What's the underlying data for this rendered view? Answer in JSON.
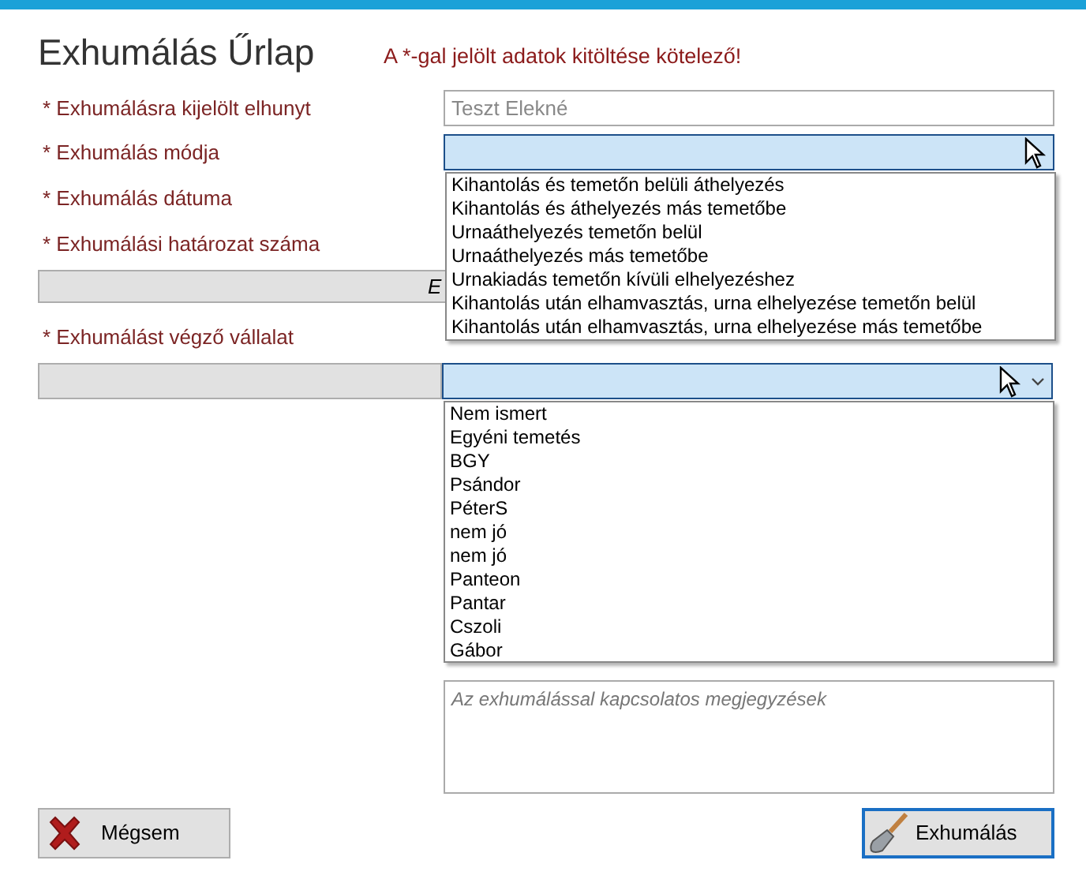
{
  "title": "Exhumálás Űrlap",
  "required_note": "A *-gal jelölt adatok kitöltése kötelező!",
  "deceased": {
    "label": "* Exhumálásra kijelölt elhunyt",
    "value": "Teszt Elekné",
    "disabled": true
  },
  "method": {
    "label": "* Exhumálás módja",
    "expanded": true,
    "options": [
      "Kihantolás és temetőn belüli áthelyezés",
      "Kihantolás és áthelyezés más temetőbe",
      "Urnaáthelyezés temetőn belül",
      "Urnaáthelyezés más temetőbe",
      "Urnakiadás temetőn kívüli elhelyezéshez",
      "Kihantolás után elhamvasztás, urna elhelyezése temetőn belül",
      "Kihantolás után elhamvasztás, urna elhelyezése más temetőbe"
    ]
  },
  "date": {
    "label": "* Exhumálás dátuma"
  },
  "resolution": {
    "label": "* Exhumálási határozat száma"
  },
  "wide_button": {
    "label": "E"
  },
  "company": {
    "label": "* Exhumálást végző vállalat",
    "expanded": true,
    "options": [
      "Nem ismert",
      "Egyéni temetés",
      "BGY",
      "Psándor",
      "PéterS",
      "nem jó",
      "nem jó",
      "Panteon",
      "Pantar",
      "Cszoli",
      "Gábor"
    ]
  },
  "notes": {
    "placeholder": "Az exhumálással kapcsolatos megjegyzések"
  },
  "buttons": [
    {
      "kind": "cancel",
      "label": "Mégsem"
    },
    {
      "kind": "exhume",
      "label": "Exhumálás"
    }
  ]
}
